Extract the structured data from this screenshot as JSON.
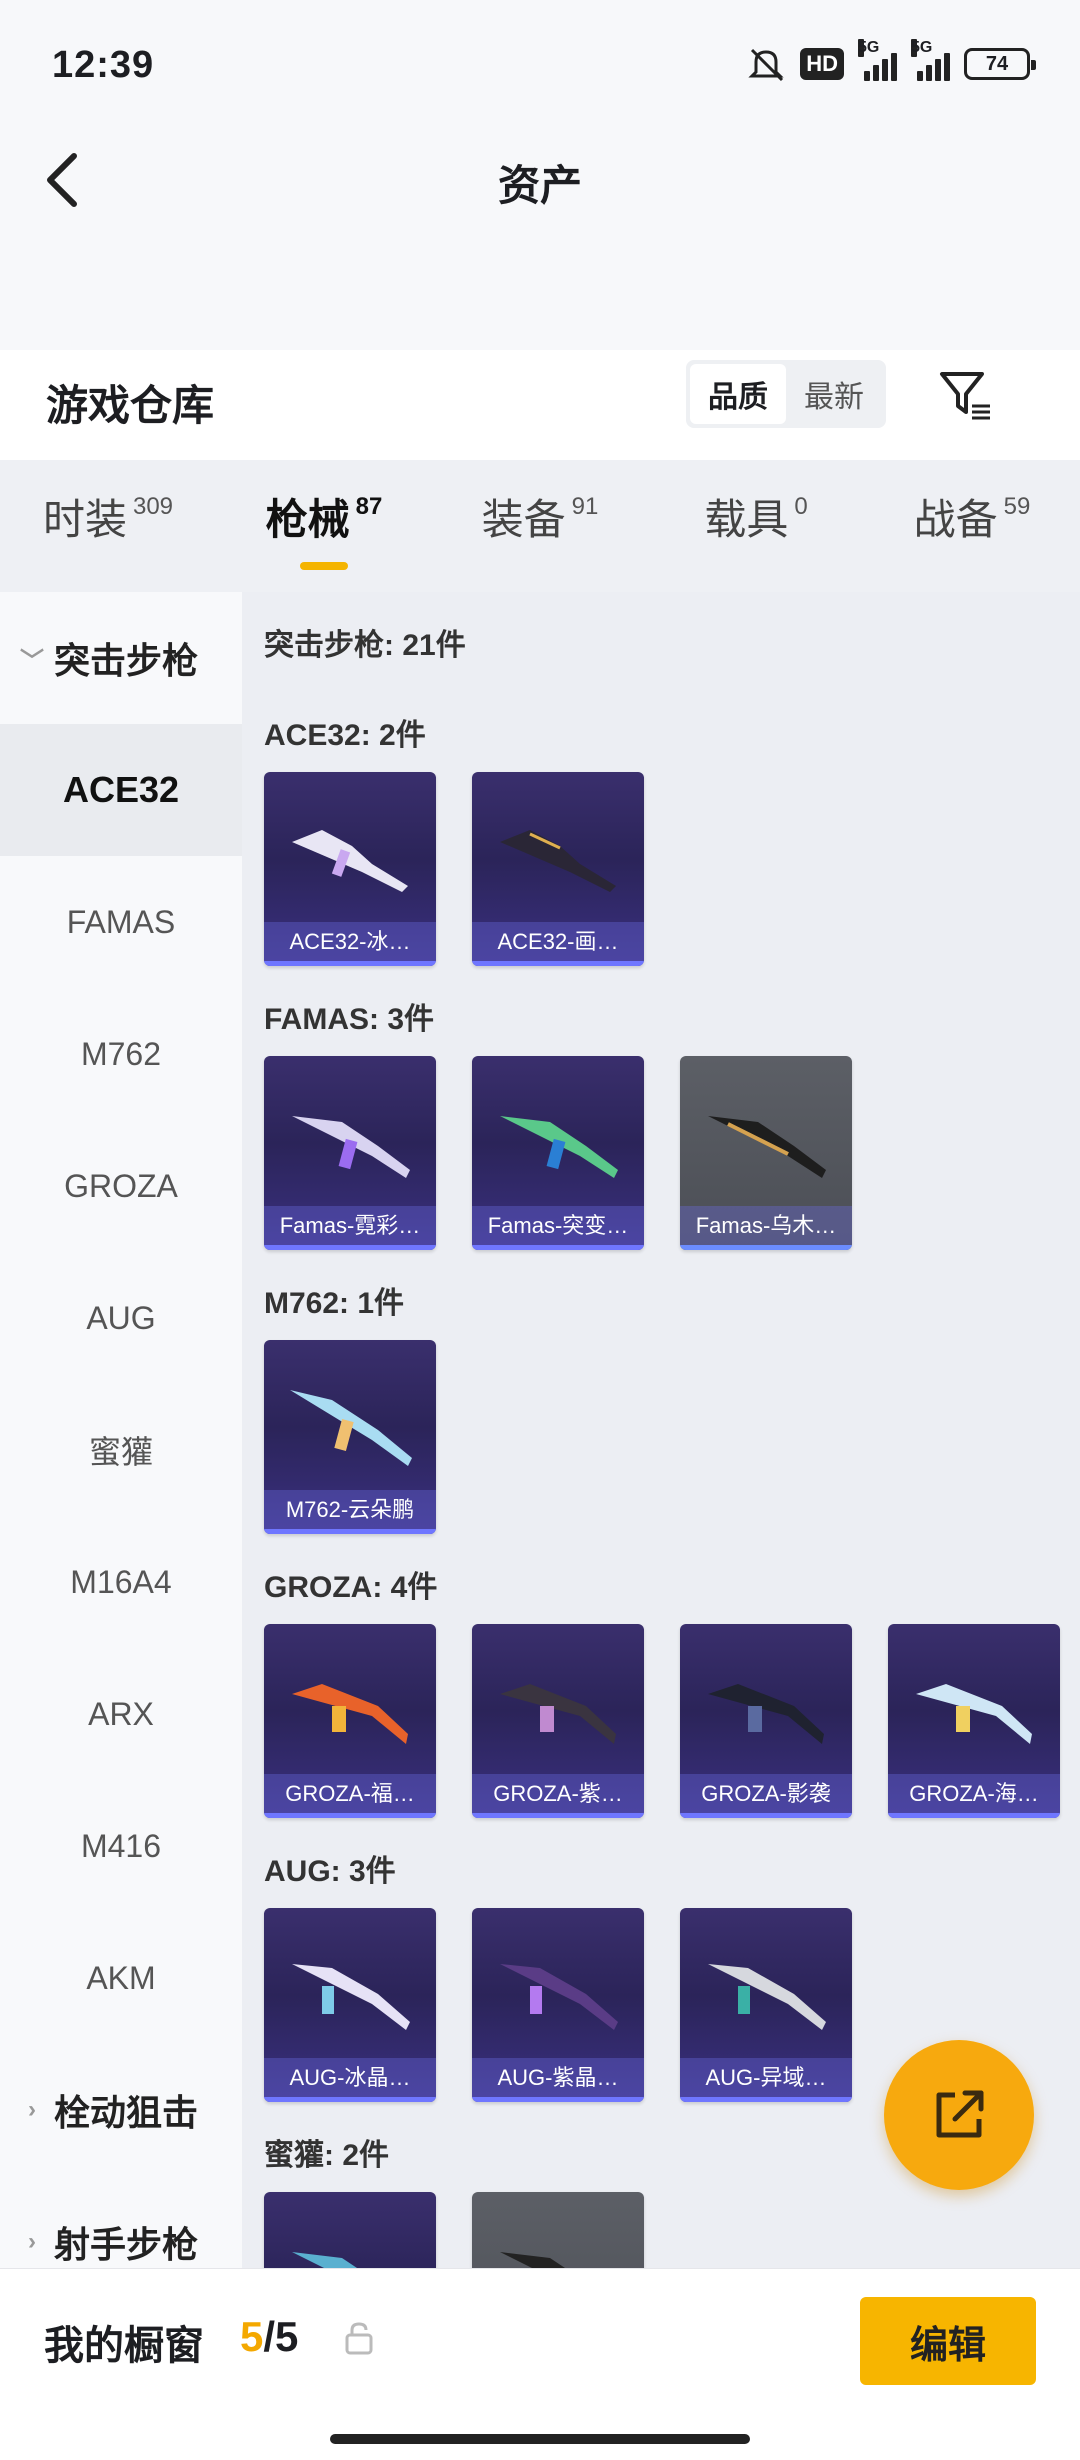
{
  "status": {
    "time": "12:39",
    "hd": "HD",
    "net1": "5G",
    "net2": "5G",
    "battery": "74"
  },
  "header": {
    "title": "资产",
    "back_icon": "chevron-left-icon"
  },
  "warehouse": {
    "title": "游戏仓库",
    "sort_options": [
      "品质",
      "最新"
    ],
    "sort_selected": "品质",
    "filter_icon": "filter-icon"
  },
  "tabs": [
    {
      "label": "时装",
      "count": "309"
    },
    {
      "label": "枪械",
      "count": "87",
      "active": true
    },
    {
      "label": "装备",
      "count": "91"
    },
    {
      "label": "载具",
      "count": "0"
    },
    {
      "label": "战备",
      "count": "59"
    }
  ],
  "sidebar": {
    "group_open": "突击步枪",
    "items": [
      "ACE32",
      "FAMAS",
      "M762",
      "GROZA",
      "AUG",
      "蜜獾",
      "M16A4",
      "ARX",
      "M416",
      "AKM"
    ],
    "selected": "ACE32",
    "groups_closed": [
      "栓动狙击",
      "射手步枪"
    ]
  },
  "main": {
    "summary": "突击步枪: 21件",
    "sections": [
      {
        "title": "ACE32: 2件",
        "items": [
          "ACE32-冰…",
          "ACE32-画…"
        ]
      },
      {
        "title": "FAMAS: 3件",
        "items": [
          "Famas-霓彩…",
          "Famas-突变…",
          "Famas-乌木…"
        ]
      },
      {
        "title": "M762: 1件",
        "items": [
          "M762-云朵鹏"
        ]
      },
      {
        "title": "GROZA: 4件",
        "items": [
          "GROZA-福…",
          "GROZA-紫…",
          "GROZA-影袭",
          "GROZA-海…"
        ]
      },
      {
        "title": "AUG: 3件",
        "items": [
          "AUG-冰晶…",
          "AUG-紫晶…",
          "AUG-异域…"
        ]
      },
      {
        "title": "蜜獾: 2件",
        "items": [
          "",
          ""
        ]
      }
    ]
  },
  "bottom": {
    "label": "我的橱窗",
    "count_a": "5",
    "count_sep": "/",
    "count_b": "5",
    "edit_label": "编辑"
  },
  "colors": {
    "accent": "#f4b400",
    "fab": "#f7a90e",
    "card_purple": "#2b2459",
    "card_gray": "#4b4e55"
  }
}
